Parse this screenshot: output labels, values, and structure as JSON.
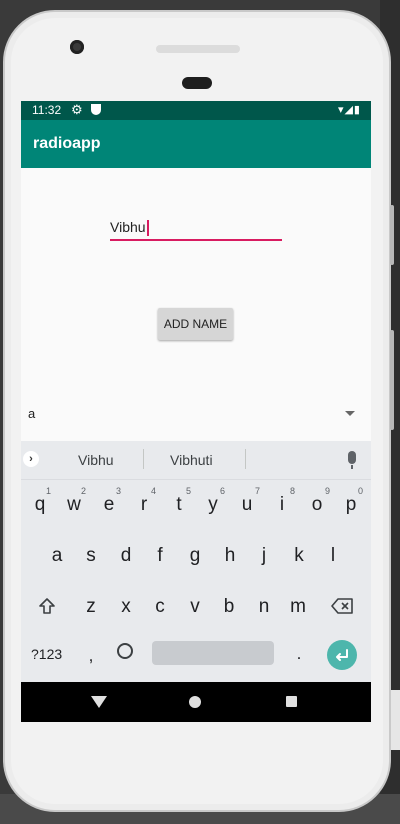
{
  "status_bar": {
    "time": "11:32",
    "icons": [
      "gear-icon",
      "shield-icon",
      "wifi-icon",
      "signal-icon",
      "battery-icon"
    ]
  },
  "app_bar": {
    "title": "radioapp"
  },
  "form": {
    "name_value": "Vibhu",
    "add_button_label": "ADD NAME",
    "spinner_value": "a"
  },
  "keyboard": {
    "suggestions": [
      "Vibhu",
      "Vibhuti"
    ],
    "row1": [
      "q",
      "w",
      "e",
      "r",
      "t",
      "y",
      "u",
      "i",
      "o",
      "p"
    ],
    "row1_hints": [
      "1",
      "2",
      "3",
      "4",
      "5",
      "6",
      "7",
      "8",
      "9",
      "0"
    ],
    "row2": [
      "a",
      "s",
      "d",
      "f",
      "g",
      "h",
      "j",
      "k",
      "l"
    ],
    "row3": [
      "z",
      "x",
      "c",
      "v",
      "b",
      "n",
      "m"
    ],
    "symbols_label": "?123",
    "comma": ",",
    "period": "."
  },
  "colors": {
    "status_bar": "#00574b",
    "app_bar": "#008577",
    "accent": "#d81b60",
    "enter_key": "#4db6ac"
  }
}
